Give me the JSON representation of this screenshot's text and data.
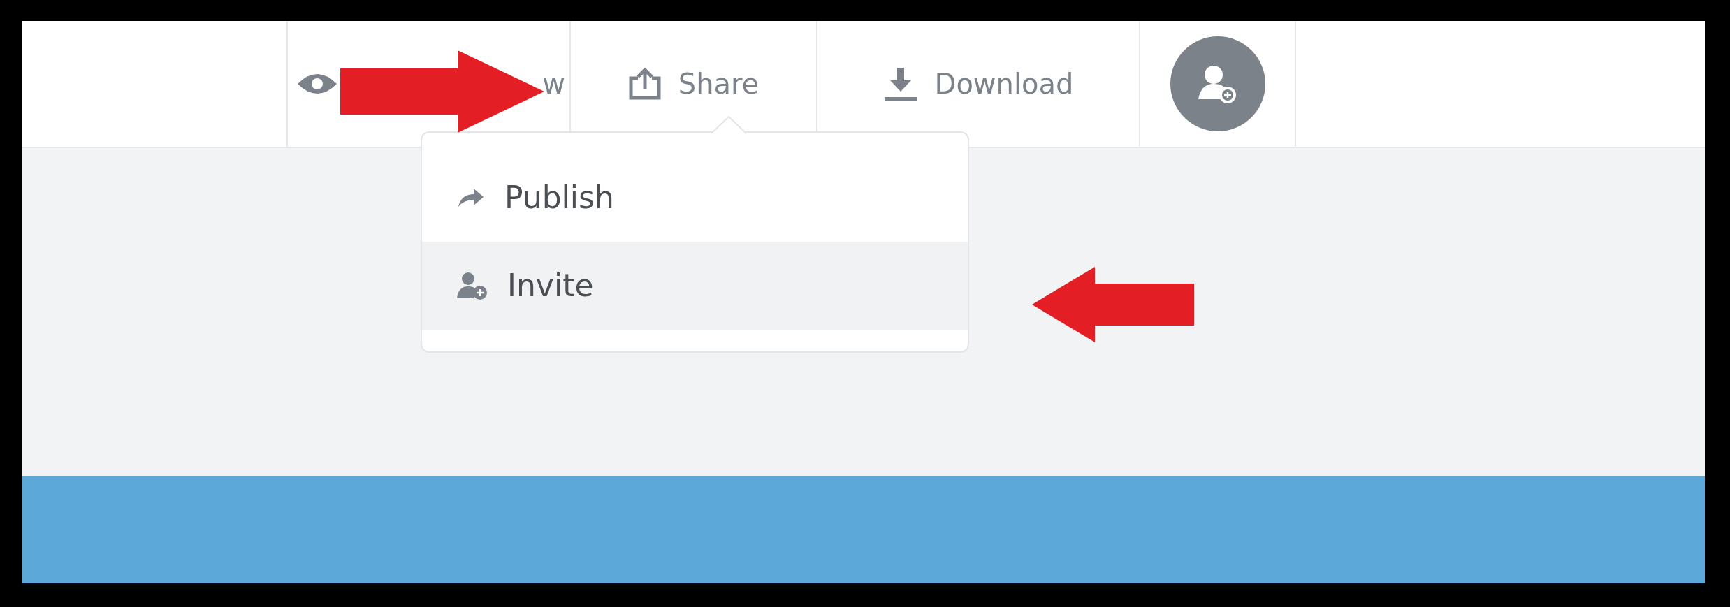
{
  "toolbar": {
    "items": [
      {
        "kind": "view",
        "label": "w"
      },
      {
        "kind": "share",
        "label": "Share",
        "expanded": true
      },
      {
        "kind": "download",
        "label": "Download"
      },
      {
        "kind": "avatar"
      }
    ]
  },
  "share_menu": {
    "items": [
      {
        "kind": "publish",
        "label": "Publish",
        "selected": false
      },
      {
        "kind": "invite",
        "label": "Invite",
        "selected": true
      }
    ]
  },
  "annotations": [
    {
      "kind": "arrow"
    },
    {
      "kind": "arrow"
    }
  ]
}
